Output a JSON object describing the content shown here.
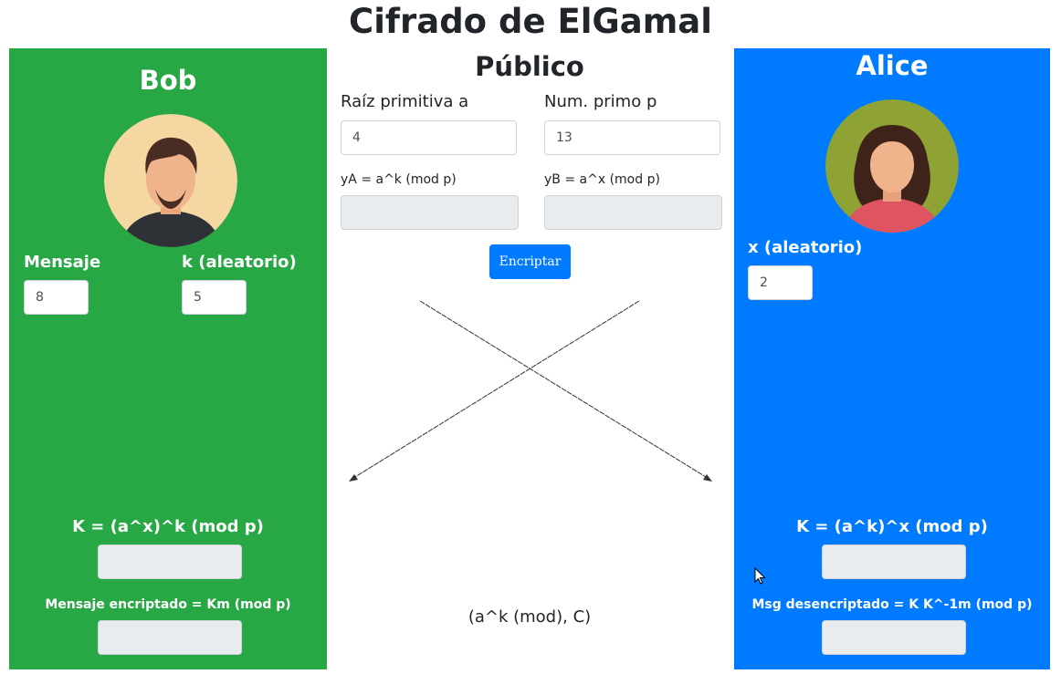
{
  "page": {
    "title": "Cifrado de ElGamal"
  },
  "bob": {
    "title": "Bob",
    "message_label": "Mensaje",
    "message_value": "8",
    "k_label": "k (aleatorio)",
    "k_value": "5",
    "shared_key_label": "K = (a^x)^k (mod p)",
    "encrypted_label": "Mensaje encriptado = Km (mod p)"
  },
  "public": {
    "title": "Público",
    "root_label": "Raíz primitiva a",
    "root_value": "4",
    "prime_label": "Num. primo p",
    "prime_value": "13",
    "ya_label": "yA = a^k (mod p)",
    "yb_label": "yB = a^x (mod p)",
    "encrypt_button": "Encriptar",
    "transit_label": "(a^k (mod), C)"
  },
  "alice": {
    "title": "Alice",
    "x_label": "x (aleatorio)",
    "x_value": "2",
    "shared_key_label": "K = (a^k)^x (mod p)",
    "decrypted_label": "Msg desencriptado = K K^-1m (mod p)"
  },
  "colors": {
    "bob_panel": "#28a745",
    "alice_panel": "#007bff",
    "button": "#007bff",
    "readonly_field": "#e9ecef"
  },
  "icons": {
    "bob_avatar": "man-avatar-icon",
    "alice_avatar": "woman-avatar-icon",
    "cursor": "mouse-pointer-icon"
  }
}
